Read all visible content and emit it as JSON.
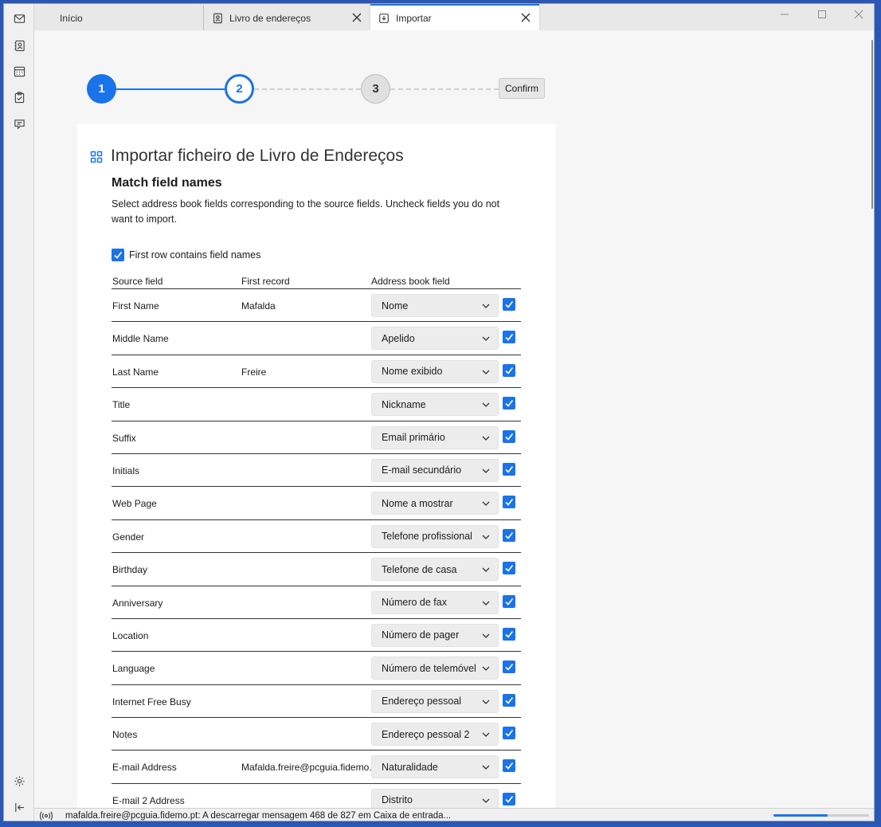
{
  "tabs": [
    {
      "label": "Início"
    },
    {
      "label": "Livro de endereços"
    },
    {
      "label": "Importar"
    }
  ],
  "stepper": {
    "steps": [
      "1",
      "2",
      "3"
    ],
    "current_step": 2,
    "confirm_label": "Confirm"
  },
  "card": {
    "title": "Importar ficheiro de Livro de Endereços",
    "heading": "Match field names",
    "description": "Select address book fields corresponding to the source fields. Uncheck fields you do not want to import.",
    "first_row_label": "First row contains field names",
    "first_row_checked": true
  },
  "table": {
    "headers": [
      "Source field",
      "First record",
      "Address book field"
    ],
    "rows": [
      {
        "source": "First Name",
        "record": "Mafalda",
        "field": "Nome",
        "checked": true
      },
      {
        "source": "Middle Name",
        "record": "",
        "field": "Apelido",
        "checked": true
      },
      {
        "source": "Last Name",
        "record": "Freire",
        "field": "Nome exibido",
        "checked": true
      },
      {
        "source": "Title",
        "record": "",
        "field": "Nickname",
        "checked": true
      },
      {
        "source": "Suffix",
        "record": "",
        "field": "Email primário",
        "checked": true
      },
      {
        "source": "Initials",
        "record": "",
        "field": "E-mail secundário",
        "checked": true
      },
      {
        "source": "Web Page",
        "record": "",
        "field": "Nome a mostrar",
        "checked": true
      },
      {
        "source": "Gender",
        "record": "",
        "field": "Telefone profissional",
        "checked": true
      },
      {
        "source": "Birthday",
        "record": "",
        "field": "Telefone de casa",
        "checked": true
      },
      {
        "source": "Anniversary",
        "record": "",
        "field": "Número de fax",
        "checked": true
      },
      {
        "source": "Location",
        "record": "",
        "field": "Número de pager",
        "checked": true
      },
      {
        "source": "Language",
        "record": "",
        "field": "Número de telemóvel",
        "checked": true
      },
      {
        "source": "Internet Free Busy",
        "record": "",
        "field": "Endereço pessoal",
        "checked": true
      },
      {
        "source": "Notes",
        "record": "",
        "field": "Endereço pessoal 2",
        "checked": true
      },
      {
        "source": "E-mail Address",
        "record": "Mafalda.freire@pcguia.fidemo.pt",
        "field": "Naturalidade",
        "checked": true
      },
      {
        "source": "E-mail 2 Address",
        "record": "",
        "field": "Distrito",
        "checked": true
      }
    ]
  },
  "statusbar": {
    "text": "mafalda.freire@pcguia.fidemo.pt: A descarregar mensagem 468 de 827 em Caixa de entrada...",
    "progress": 0.57
  },
  "colors": {
    "accent": "#1a73e8"
  }
}
